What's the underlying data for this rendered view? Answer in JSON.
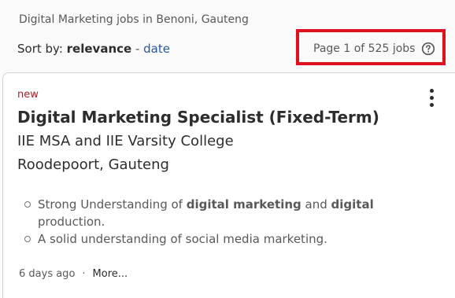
{
  "breadcrumb": "Digital Marketing jobs in Benoni, Gauteng",
  "sort": {
    "prefix": "Sort by: ",
    "active": "relevance",
    "separator": " - ",
    "alt": "date"
  },
  "pagination": {
    "text": "Page 1 of 525 jobs",
    "help_icon": "question-circle-icon"
  },
  "highlight_color": "#e0101c",
  "job": {
    "badge": "new",
    "title": "Digital Marketing Specialist (Fixed-Term)",
    "company": "IIE MSA and IIE Varsity College",
    "location": "Roodepoort, Gauteng",
    "snippet": {
      "b1_pre": "Strong Understanding of ",
      "b1_bold1": "digital marketing",
      "b1_mid": " and ",
      "b1_bold2": "digital",
      "b1_post": " production.",
      "b2": "A solid understanding of social media marketing."
    },
    "posted": "6 days ago",
    "dot": "·",
    "more": "More..."
  }
}
